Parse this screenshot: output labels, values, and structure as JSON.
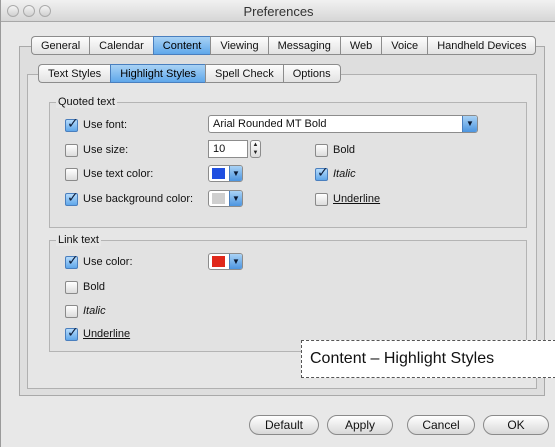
{
  "window": {
    "title": "Preferences"
  },
  "main_tabs": [
    {
      "label": "General",
      "selected": false
    },
    {
      "label": "Calendar",
      "selected": false
    },
    {
      "label": "Content",
      "selected": true
    },
    {
      "label": "Viewing",
      "selected": false
    },
    {
      "label": "Messaging",
      "selected": false
    },
    {
      "label": "Web",
      "selected": false
    },
    {
      "label": "Voice",
      "selected": false
    },
    {
      "label": "Handheld Devices",
      "selected": false
    }
  ],
  "sub_tabs": [
    {
      "label": "Text Styles",
      "selected": false
    },
    {
      "label": "Highlight Styles",
      "selected": true
    },
    {
      "label": "Spell Check",
      "selected": false
    },
    {
      "label": "Options",
      "selected": false
    }
  ],
  "quoted": {
    "label": "Quoted text",
    "use_font": {
      "label": "Use font:",
      "checked": true
    },
    "font_value": "Arial Rounded MT Bold",
    "use_size": {
      "label": "Use size:",
      "checked": false
    },
    "size_value": "10",
    "bold": {
      "label": "Bold",
      "checked": false
    },
    "use_text_color": {
      "label": "Use text color:",
      "checked": false
    },
    "text_color": "#1f4fe0",
    "italic": {
      "label": "Italic",
      "checked": true
    },
    "use_bg_color": {
      "label": "Use background color:",
      "checked": true
    },
    "bg_color": "#cfcfcf",
    "underline": {
      "label": "Underline",
      "checked": false
    }
  },
  "link": {
    "label": "Link text",
    "use_color": {
      "label": "Use color:",
      "checked": true
    },
    "color": "#e0281b",
    "bold": {
      "label": "Bold",
      "checked": false
    },
    "italic": {
      "label": "Italic",
      "checked": false
    },
    "underline": {
      "label": "Underline",
      "checked": true
    }
  },
  "buttons": {
    "default": "Default",
    "apply": "Apply",
    "cancel": "Cancel",
    "ok": "OK"
  },
  "caption": "Content – Highlight Styles"
}
